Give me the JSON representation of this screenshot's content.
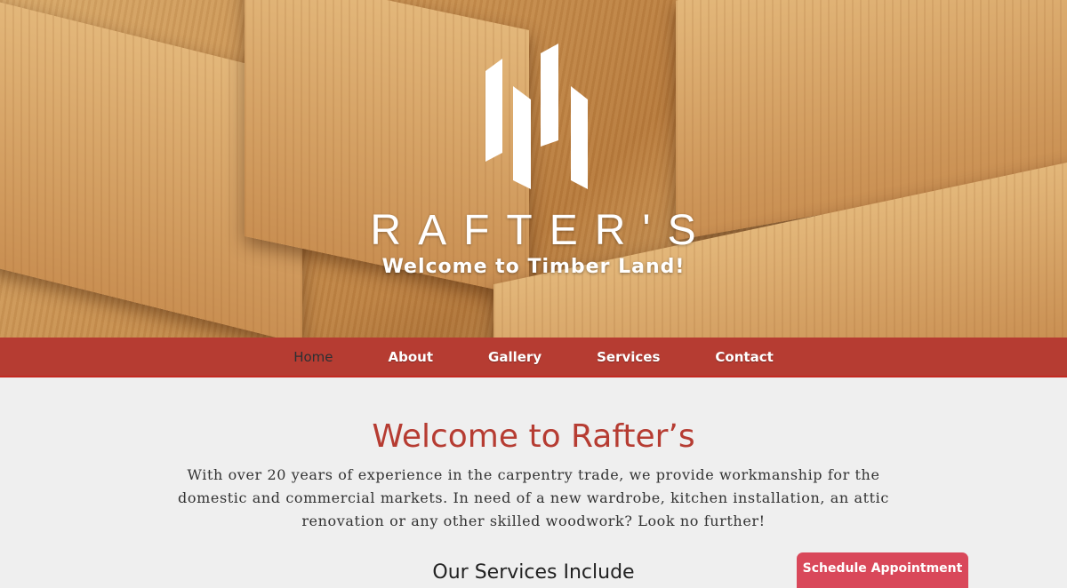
{
  "hero": {
    "brand": "RAFTER'S",
    "tagline": "Welcome to Timber Land!"
  },
  "nav": {
    "items": [
      {
        "label": "Home",
        "active": true
      },
      {
        "label": "About"
      },
      {
        "label": "Gallery"
      },
      {
        "label": "Services"
      },
      {
        "label": "Contact"
      }
    ]
  },
  "main": {
    "title": "Welcome to Rafter’s",
    "intro": "With over 20 years of experience in the carpentry trade, we provide workmanship for the domestic and commercial markets. In need of a new wardrobe, kitchen installation, an attic renovation or any other skilled woodwork? Look no further!",
    "services_heading": "Our Services Include"
  },
  "cta": {
    "label": "Schedule Appointment"
  },
  "colors": {
    "nav": "#b63c32",
    "accent": "#b63c32",
    "cta": "#d9485a"
  }
}
